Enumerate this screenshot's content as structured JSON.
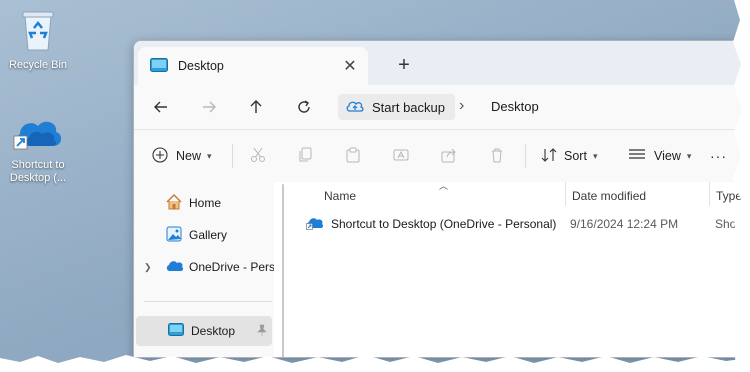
{
  "desktop": {
    "icons": [
      {
        "label": "Recycle Bin",
        "icon": "recycle-bin-icon"
      },
      {
        "label": "Shortcut to Desktop (...",
        "icon": "onedrive-shortcut-icon"
      }
    ]
  },
  "window": {
    "tab": {
      "title": "Desktop",
      "close": "✕",
      "new_tab": "+"
    },
    "address": {
      "backup_label": "Start backup",
      "separator": "›",
      "current": "Desktop"
    },
    "commands": {
      "new_label": "New",
      "sort_label": "Sort",
      "view_label": "View",
      "more": "···"
    },
    "nav": {
      "items": [
        {
          "label": "Home",
          "icon": "home-icon"
        },
        {
          "label": "Gallery",
          "icon": "gallery-icon"
        },
        {
          "label": "OneDrive - Personal",
          "icon": "onedrive-icon"
        },
        {
          "label": "Desktop",
          "icon": "desktop-folder-icon",
          "selected": true
        }
      ]
    },
    "columns": {
      "name": "Name",
      "date": "Date modified",
      "type": "Type"
    },
    "files": [
      {
        "name": "Shortcut to Desktop (OneDrive - Personal)",
        "date": "9/16/2024 12:24 PM",
        "type": "Shortcut"
      }
    ]
  },
  "colors": {
    "accent": "#0f6cbd",
    "onedrive_blue": "#1f7fd6",
    "desktop_bg": "#9bb4cb"
  }
}
